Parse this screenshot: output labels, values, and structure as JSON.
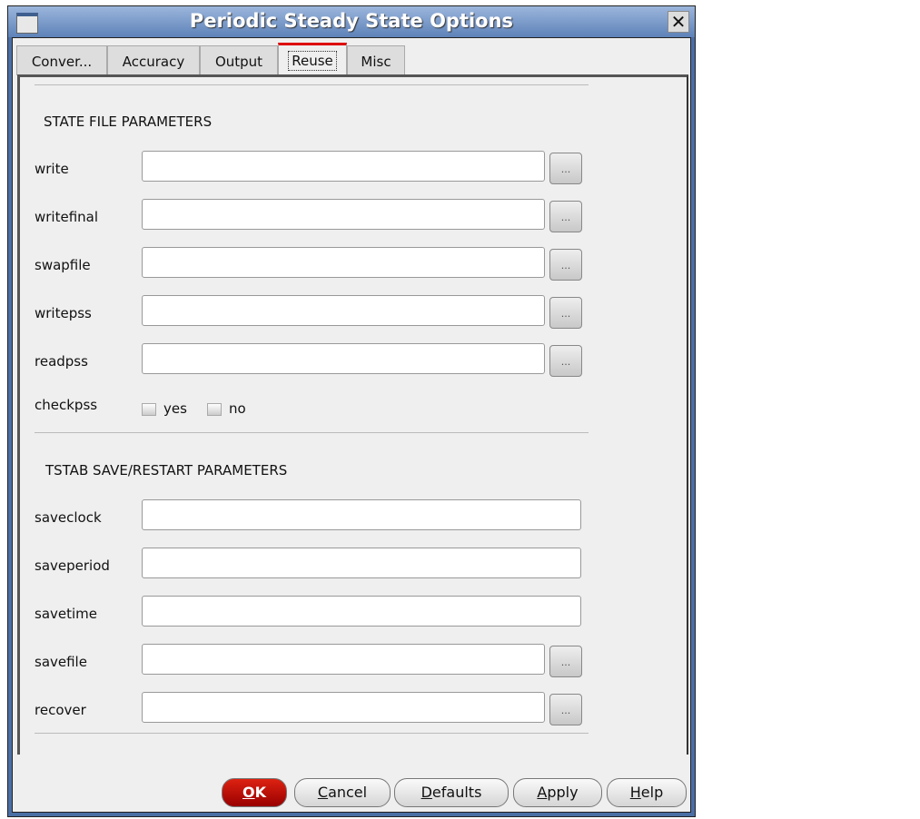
{
  "window": {
    "title": "Periodic Steady State Options",
    "close_glyph": "✕"
  },
  "tabs": [
    {
      "label": "Conver..."
    },
    {
      "label": "Accuracy"
    },
    {
      "label": "Output"
    },
    {
      "label": "Reuse"
    },
    {
      "label": "Misc"
    }
  ],
  "active_tab": "Reuse",
  "state_section": {
    "header": "STATE FILE PARAMETERS",
    "fields": [
      {
        "label": "write",
        "value": ""
      },
      {
        "label": "writefinal",
        "value": ""
      },
      {
        "label": "swapfile",
        "value": ""
      },
      {
        "label": "writepss",
        "value": ""
      },
      {
        "label": "readpss",
        "value": ""
      }
    ],
    "checkpss": {
      "label": "checkpss",
      "options": [
        {
          "label": "yes",
          "checked": false
        },
        {
          "label": "no",
          "checked": false
        }
      ]
    }
  },
  "tstab_section": {
    "header": "TSTAB SAVE/RESTART PARAMETERS",
    "fields": [
      {
        "label": "saveclock",
        "value": ""
      },
      {
        "label": "saveperiod",
        "value": ""
      },
      {
        "label": "savetime",
        "value": ""
      },
      {
        "label": "savefile",
        "value": ""
      },
      {
        "label": "recover",
        "value": ""
      }
    ]
  },
  "browse_label": "...",
  "buttons": {
    "ok": {
      "key": "O",
      "rest": "K"
    },
    "cancel": {
      "key": "C",
      "rest": "ancel"
    },
    "defaults": {
      "key": "D",
      "rest": "efaults"
    },
    "apply": {
      "key": "A",
      "rest": "pply"
    },
    "help": {
      "key": "H",
      "rest": "elp"
    }
  }
}
